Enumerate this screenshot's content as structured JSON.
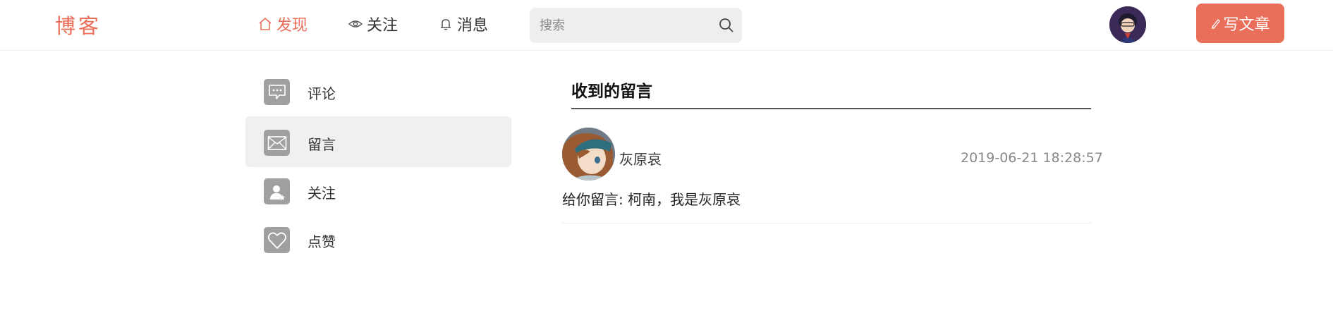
{
  "header": {
    "logo": "博客",
    "nav": [
      {
        "label": "发现",
        "icon": "home-icon",
        "active": true
      },
      {
        "label": "关注",
        "icon": "eye-icon",
        "active": false
      },
      {
        "label": "消息",
        "icon": "bell-icon",
        "active": false
      }
    ],
    "search": {
      "placeholder": "搜索",
      "value": ""
    },
    "write_button": "写文章"
  },
  "sidebar": {
    "items": [
      {
        "label": "评论",
        "icon": "comment-icon",
        "active": false
      },
      {
        "label": "留言",
        "icon": "mail-icon",
        "active": true
      },
      {
        "label": "关注",
        "icon": "user-follow-icon",
        "active": false
      },
      {
        "label": "点赞",
        "icon": "heart-icon",
        "active": false
      }
    ]
  },
  "main": {
    "title": "收到的留言",
    "messages": [
      {
        "user": "灰原哀",
        "time": "2019-06-21 18:28:57",
        "content": "给你留言: 柯南，我是灰原哀"
      }
    ]
  },
  "colors": {
    "accent": "#ea6f5a",
    "sidebar_icon_bg": "#a0a0a0",
    "active_bg": "#f0f0f0"
  }
}
